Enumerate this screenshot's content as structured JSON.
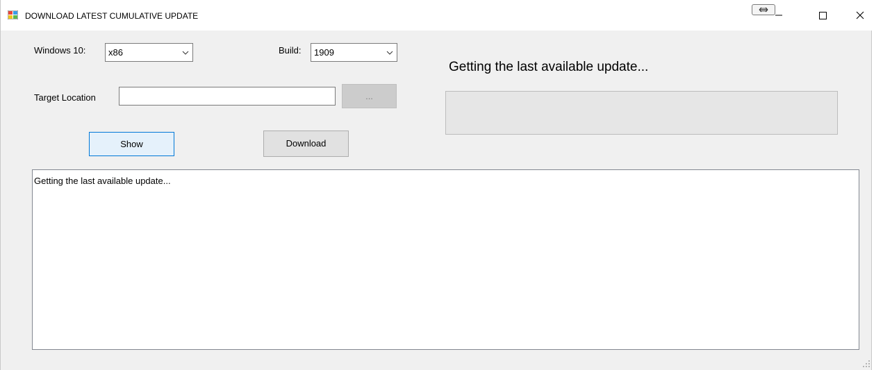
{
  "window": {
    "title": "DOWNLOAD LATEST CUMULATIVE UPDATE",
    "controls": [
      "snap-layout",
      "minimize",
      "maximize",
      "close"
    ]
  },
  "form": {
    "windows_label": "Windows 10:",
    "windows_value": "x86",
    "build_label": "Build:",
    "build_value": "1909",
    "target_label": "Target Location",
    "target_value": "",
    "browse_label": "...",
    "show_label": "Show",
    "download_label": "Download"
  },
  "status": {
    "heading": "Getting the last available update...",
    "progress": 0
  },
  "log": {
    "text": "Getting the last available update..."
  },
  "colors": {
    "window_bg": "#f0f0f0",
    "focus_border": "#0078d7",
    "focus_bg": "#e5f1fb",
    "progress_track": "#e6e6e6"
  }
}
